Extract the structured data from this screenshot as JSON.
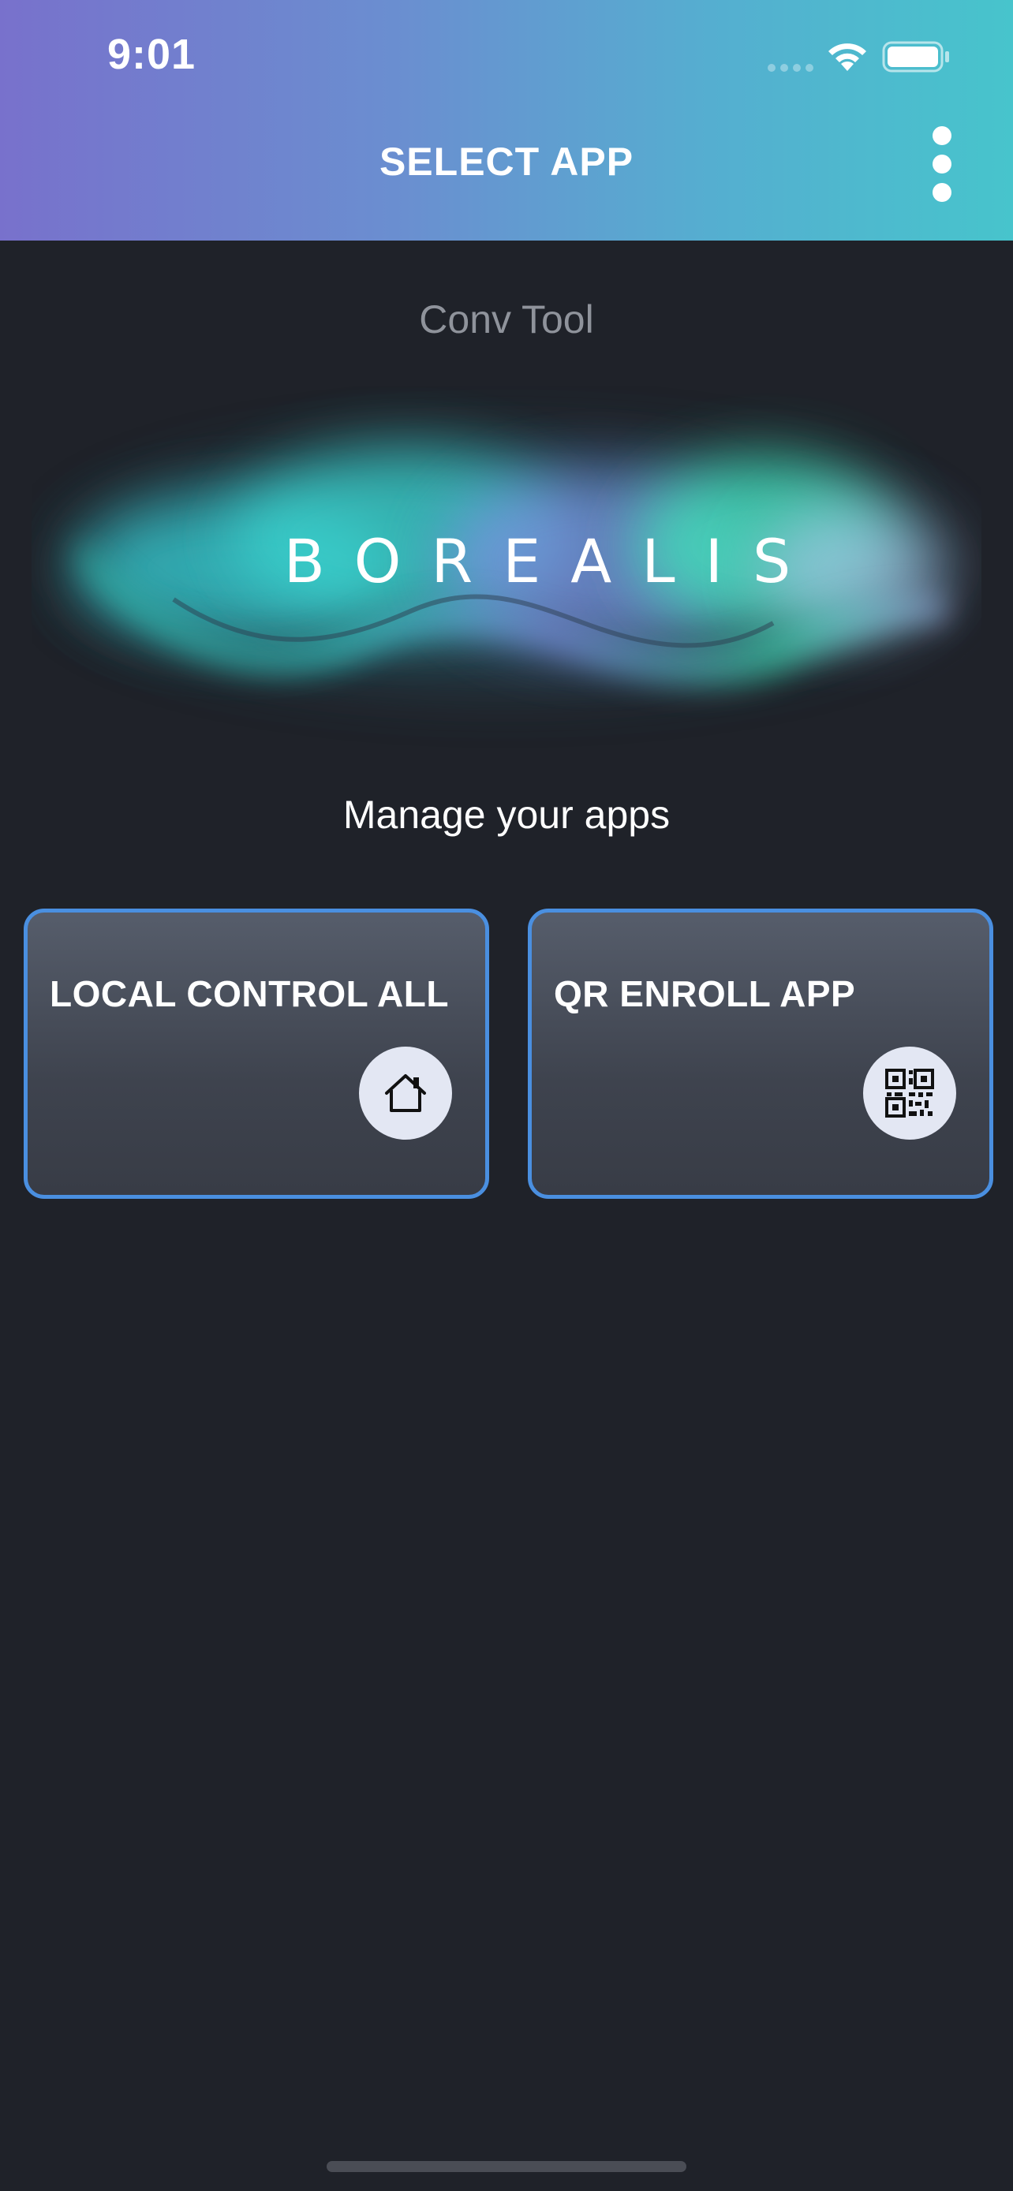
{
  "status_bar": {
    "time": "9:01",
    "signal_icon": "cellular-signal-icon",
    "wifi_icon": "wifi-icon",
    "battery_icon": "battery-icon"
  },
  "header": {
    "title": "SELECT APP",
    "menu_icon": "more-vertical-icon"
  },
  "subtitle": "Conv Tool",
  "logo": {
    "text": "BOREALIS",
    "colors": [
      "#3ad6d0",
      "#7a8fe0",
      "#3fe0b8"
    ]
  },
  "tagline": "Manage your apps",
  "apps": [
    {
      "label": "LOCAL CONTROL ALL",
      "icon": "home-icon"
    },
    {
      "label": "QR ENROLL APP",
      "icon": "qr-code-icon"
    }
  ],
  "colors": {
    "header_gradient_start": "#7871cc",
    "header_gradient_end": "#47c4cc",
    "background": "#1f2229",
    "card_border": "#4a8fe0",
    "icon_circle": "#e3e7f3"
  }
}
